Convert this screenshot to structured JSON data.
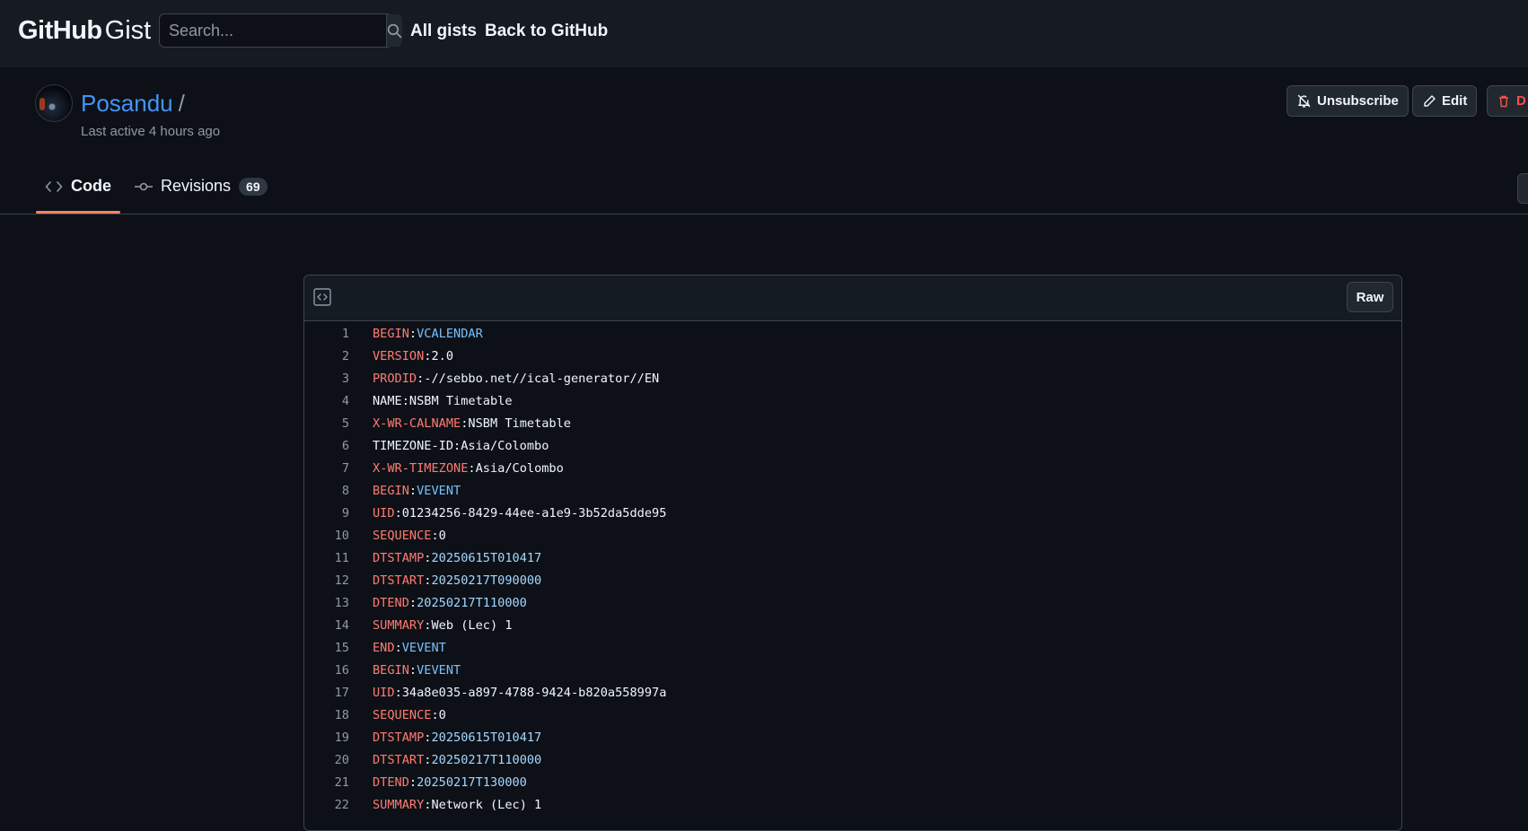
{
  "header": {
    "brand_bold": "GitHub",
    "brand_light": "Gist",
    "search_placeholder": "Search...",
    "nav": [
      "All gists",
      "Back to GitHub"
    ]
  },
  "gist": {
    "owner": "Posandu",
    "separator": "/",
    "last_active": "Last active 4 hours ago",
    "actions": {
      "unsubscribe": "Unsubscribe",
      "edit": "Edit",
      "delete_partial": "D"
    }
  },
  "tabs": [
    {
      "label": "Code",
      "icon": "code-icon"
    },
    {
      "label": "Revisions",
      "icon": "git-commit-icon",
      "count": "69"
    }
  ],
  "file": {
    "raw_label": "Raw",
    "lines": [
      {
        "n": "1",
        "key": "BEGIN",
        "sep": ":",
        "val": "VCALENDAR",
        "kind": "v"
      },
      {
        "n": "2",
        "key": "VERSION",
        "sep": ":",
        "val": "2.0",
        "kind": "p"
      },
      {
        "n": "3",
        "key": "PRODID",
        "sep": ":",
        "val": "-//sebbo.net//ical-generator//EN",
        "kind": "p"
      },
      {
        "n": "4",
        "key": "",
        "sep": "",
        "val": "NAME:NSBM Timetable",
        "kind": "plain"
      },
      {
        "n": "5",
        "key": "X-WR-CALNAME",
        "sep": ":",
        "val": "NSBM Timetable",
        "kind": "p"
      },
      {
        "n": "6",
        "key": "",
        "sep": "",
        "val": "TIMEZONE-ID:Asia/Colombo",
        "kind": "plain"
      },
      {
        "n": "7",
        "key": "X-WR-TIMEZONE",
        "sep": ":",
        "val": "Asia/Colombo",
        "kind": "p"
      },
      {
        "n": "8",
        "key": "BEGIN",
        "sep": ":",
        "val": "VEVENT",
        "kind": "v"
      },
      {
        "n": "9",
        "key": "UID",
        "sep": ":",
        "val": "01234256-8429-44ee-a1e9-3b52da5dde95",
        "kind": "p"
      },
      {
        "n": "10",
        "key": "SEQUENCE",
        "sep": ":",
        "val": "0",
        "kind": "p"
      },
      {
        "n": "11",
        "key": "DTSTAMP",
        "sep": ":",
        "val": "20250615T010417",
        "kind": "d"
      },
      {
        "n": "12",
        "key": "DTSTART",
        "sep": ":",
        "val": "20250217T090000",
        "kind": "d"
      },
      {
        "n": "13",
        "key": "DTEND",
        "sep": ":",
        "val": "20250217T110000",
        "kind": "d"
      },
      {
        "n": "14",
        "key": "SUMMARY",
        "sep": ":",
        "val": "Web (Lec) 1",
        "kind": "p"
      },
      {
        "n": "15",
        "key": "END",
        "sep": ":",
        "val": "VEVENT",
        "kind": "v"
      },
      {
        "n": "16",
        "key": "BEGIN",
        "sep": ":",
        "val": "VEVENT",
        "kind": "v"
      },
      {
        "n": "17",
        "key": "UID",
        "sep": ":",
        "val": "34a8e035-a897-4788-9424-b820a558997a",
        "kind": "p"
      },
      {
        "n": "18",
        "key": "SEQUENCE",
        "sep": ":",
        "val": "0",
        "kind": "p"
      },
      {
        "n": "19",
        "key": "DTSTAMP",
        "sep": ":",
        "val": "20250615T010417",
        "kind": "d"
      },
      {
        "n": "20",
        "key": "DTSTART",
        "sep": ":",
        "val": "20250217T110000",
        "kind": "d"
      },
      {
        "n": "21",
        "key": "DTEND",
        "sep": ":",
        "val": "20250217T130000",
        "kind": "d"
      },
      {
        "n": "22",
        "key": "SUMMARY",
        "sep": ":",
        "val": "Network (Lec) 1",
        "kind": "p"
      }
    ]
  },
  "colors": {
    "background": "#0d1117",
    "header": "#161b22",
    "link": "#4493f8",
    "accent": "#f78166"
  }
}
